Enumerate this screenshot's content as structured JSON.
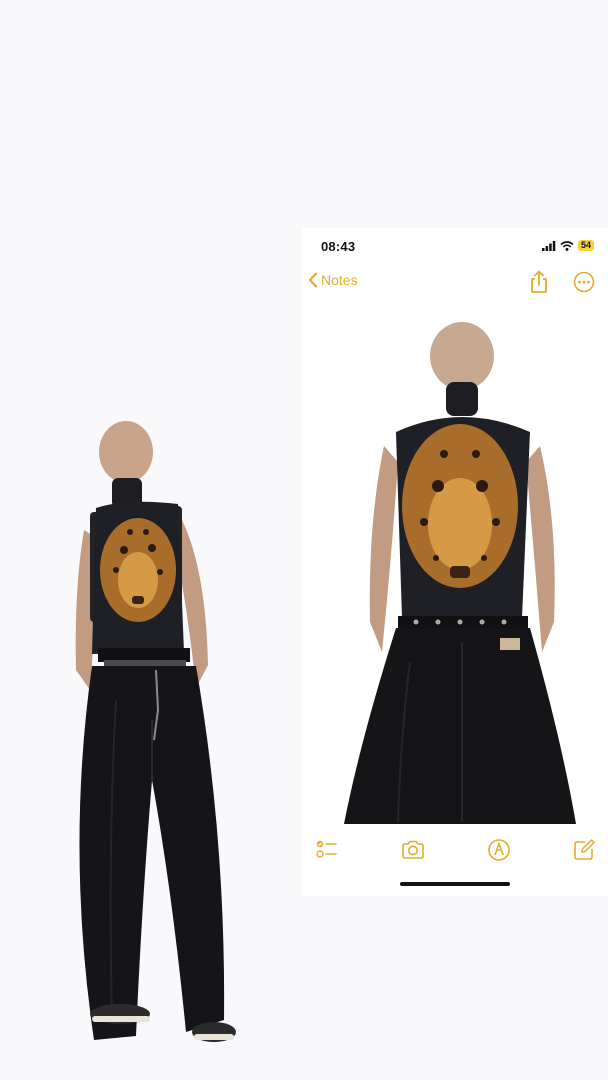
{
  "status_bar": {
    "time": "08:43",
    "battery": "54"
  },
  "nav": {
    "back_label": "Notes"
  },
  "colors": {
    "accent": "#e2ad2c",
    "background": "#f9f9fc"
  },
  "icons": {
    "back": "chevron-left-icon",
    "share": "share-icon",
    "more": "ellipsis-circle-icon",
    "checklist": "checklist-icon",
    "camera": "camera-icon",
    "markup": "markup-pen-icon",
    "compose": "compose-icon"
  }
}
